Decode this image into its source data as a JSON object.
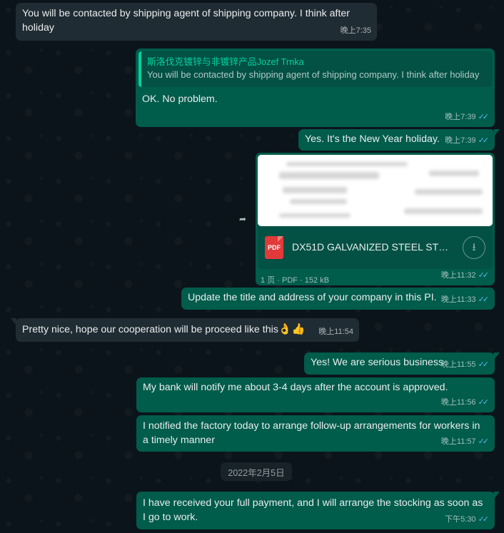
{
  "messages": [
    {
      "text": "You will be contacted by shipping agent of shipping company. I think after holiday",
      "time": "晚上7:35"
    },
    {
      "quote_author": "斯洛伐克镀锌与非镀锌产品Jozef Trnka",
      "quote_text": "You will be contacted by shipping agent of shipping company. I think after holiday",
      "text": "OK. No problem.",
      "time": "晚上7:39",
      "status": "read"
    },
    {
      "text": "Yes. It's the New Year holiday.",
      "time": "晚上7:39",
      "status": "read"
    },
    {
      "document": {
        "name": "DX51D GALVANIZED STEEL STRI...",
        "pages": "1 页",
        "type": "PDF",
        "size": "152 kB",
        "icon_label": "PDF"
      },
      "time": "晚上11:32",
      "status": "read"
    },
    {
      "text": "Update the title and address of your company in this PI.",
      "time": "晚上11:33",
      "status": "read"
    },
    {
      "text": "Pretty nice, hope our cooperation will be proceed like this",
      "emoji": "👌👍",
      "time": "晚上11:54"
    },
    {
      "text": "Yes! We are serious business",
      "time": "晚上11:55",
      "status": "read"
    },
    {
      "text": "My bank will notify me about 3-4 days after the account is approved.",
      "time": "晚上11:56",
      "status": "read"
    },
    {
      "text": "I notified the factory today to arrange follow-up arrangements for workers in a timely manner",
      "time": "晚上11:57",
      "status": "read"
    },
    {
      "text": "I have received your full payment, and I will arrange the stocking as soon as I go to work.",
      "time": "下午5:30",
      "status": "read"
    }
  ],
  "date_separator": "2022年2月5日",
  "icons": {
    "forward": "forward-icon",
    "download": "download-icon",
    "read_receipt": "double-check-icon",
    "file": "pdf-file-icon"
  },
  "colors": {
    "incoming_bubble": "#202c33",
    "outgoing_bubble": "#005c4b",
    "read_ticks": "#53bdeb",
    "quote_accent": "#06cf9c",
    "pdf_red": "#e23a3a"
  }
}
